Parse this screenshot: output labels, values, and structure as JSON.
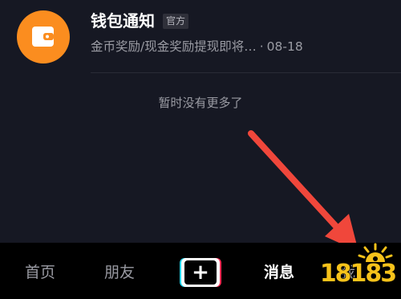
{
  "notification": {
    "title": "钱包通知",
    "badge": "官方",
    "preview": "金币奖励/现金奖励提现即将…",
    "separator": "·",
    "date": "08-18",
    "avatar_color": "#fb8d1f",
    "avatar_icon": "wallet-icon"
  },
  "empty_hint": "暂时没有更多了",
  "tab_bar": {
    "home": "首页",
    "friends": "朋友",
    "plus": "+",
    "messages": "消息",
    "me": "我"
  },
  "watermark": {
    "text": "18183",
    "color": "#f6c21a"
  },
  "colors": {
    "background": "#161823",
    "tab_bar": "#000000",
    "arrow": "#f0473b",
    "secondary_text": "#9a9ba3"
  }
}
